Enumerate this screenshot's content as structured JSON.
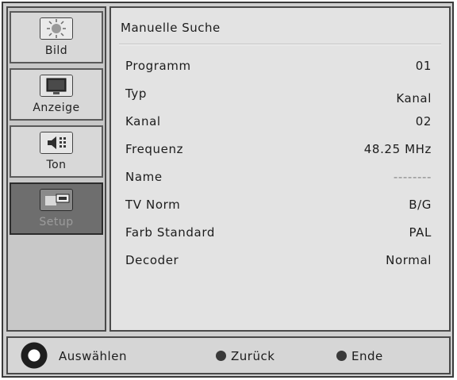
{
  "sidebar": {
    "items": [
      {
        "label": "Bild",
        "icon": "sun-icon"
      },
      {
        "label": "Anzeige",
        "icon": "monitor-icon"
      },
      {
        "label": "Ton",
        "icon": "speaker-icon"
      },
      {
        "label": "Setup",
        "icon": "setup-icon",
        "active": true
      }
    ]
  },
  "panel": {
    "title": "Manuelle Suche",
    "rows": [
      {
        "label": "Programm",
        "value": "01"
      },
      {
        "label": "Typ",
        "value": "Kanal"
      },
      {
        "label": "Kanal",
        "value": "02"
      },
      {
        "label": "Frequenz",
        "value": "48.25 MHz"
      },
      {
        "label": "Name",
        "value": "--------"
      },
      {
        "label": "TV Norm",
        "value": "B/G"
      },
      {
        "label": "Farb Standard",
        "value": "PAL"
      },
      {
        "label": "Decoder",
        "value": "Normal"
      }
    ]
  },
  "footer": {
    "select_label": "Auswählen",
    "back_label": "Zurück",
    "end_label": "Ende"
  }
}
